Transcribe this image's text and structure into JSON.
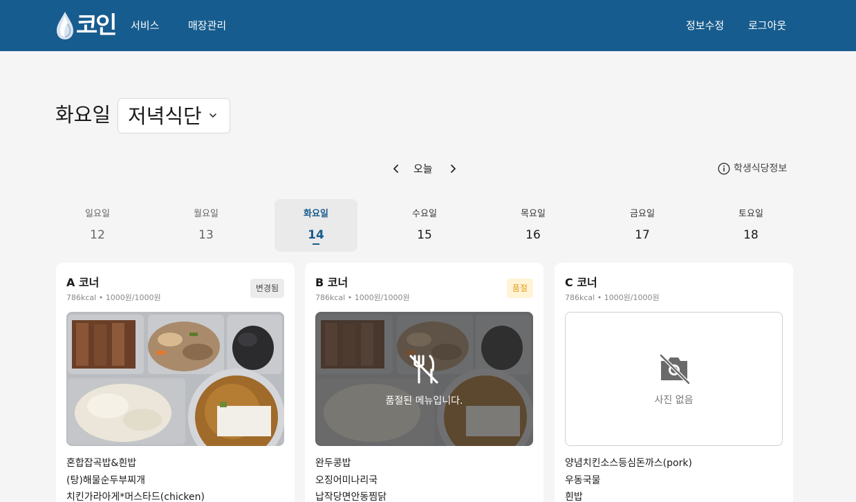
{
  "header": {
    "logo_text": "코인",
    "nav": [
      "서비스",
      "매장관리"
    ],
    "account": [
      "정보수정",
      "로그아웃"
    ]
  },
  "page": {
    "day_title": "화요일",
    "meal_select": "저녁식단"
  },
  "week_nav": {
    "today_label": "오늘",
    "info_label": "학생식당정보"
  },
  "days": [
    {
      "name": "일요일",
      "date": "12"
    },
    {
      "name": "월요일",
      "date": "13"
    },
    {
      "name": "화요일",
      "date": "14"
    },
    {
      "name": "수요일",
      "date": "15"
    },
    {
      "name": "목요일",
      "date": "16"
    },
    {
      "name": "금요일",
      "date": "17"
    },
    {
      "name": "토요일",
      "date": "18"
    }
  ],
  "selected_day": "화요일",
  "cards": [
    {
      "title": "A 코너",
      "meta": "786kcal • 1000원/1000원",
      "badge": "변경됨",
      "menu": [
        "혼합잡곡밥&흰밥",
        "(탕)해물순두부찌개",
        "치킨가라아게*머스타드(chicken)"
      ]
    },
    {
      "title": "B 코너",
      "meta": "786kcal • 1000원/1000원",
      "badge": "품절",
      "overlay_text": "품절된 메뉴입니다.",
      "menu": [
        "완두콩밥",
        "오징어미나리국",
        "납작당면안동찜닭"
      ]
    },
    {
      "title": "C 코너",
      "meta": "786kcal • 1000원/1000원",
      "no_photo_text": "사진 없음",
      "menu": [
        "양념치킨소스등심돈까스(pork)",
        "우동국물",
        "흰밥"
      ]
    }
  ],
  "colors": {
    "header_bg": "#175c8e",
    "accent": "#175c8e",
    "soldout_badge_text": "#e49a1d",
    "soldout_badge_bg": "#fff4d6",
    "page_bg": "#f5f5f5"
  },
  "icons": {
    "logo": "droplet-logo-icon",
    "prev": "chevron-left-icon",
    "next": "chevron-right-icon",
    "info": "info-circle-icon",
    "dropdown": "chevron-down-icon",
    "soldout": "no-utensils-icon",
    "no_photo": "no-camera-icon"
  }
}
